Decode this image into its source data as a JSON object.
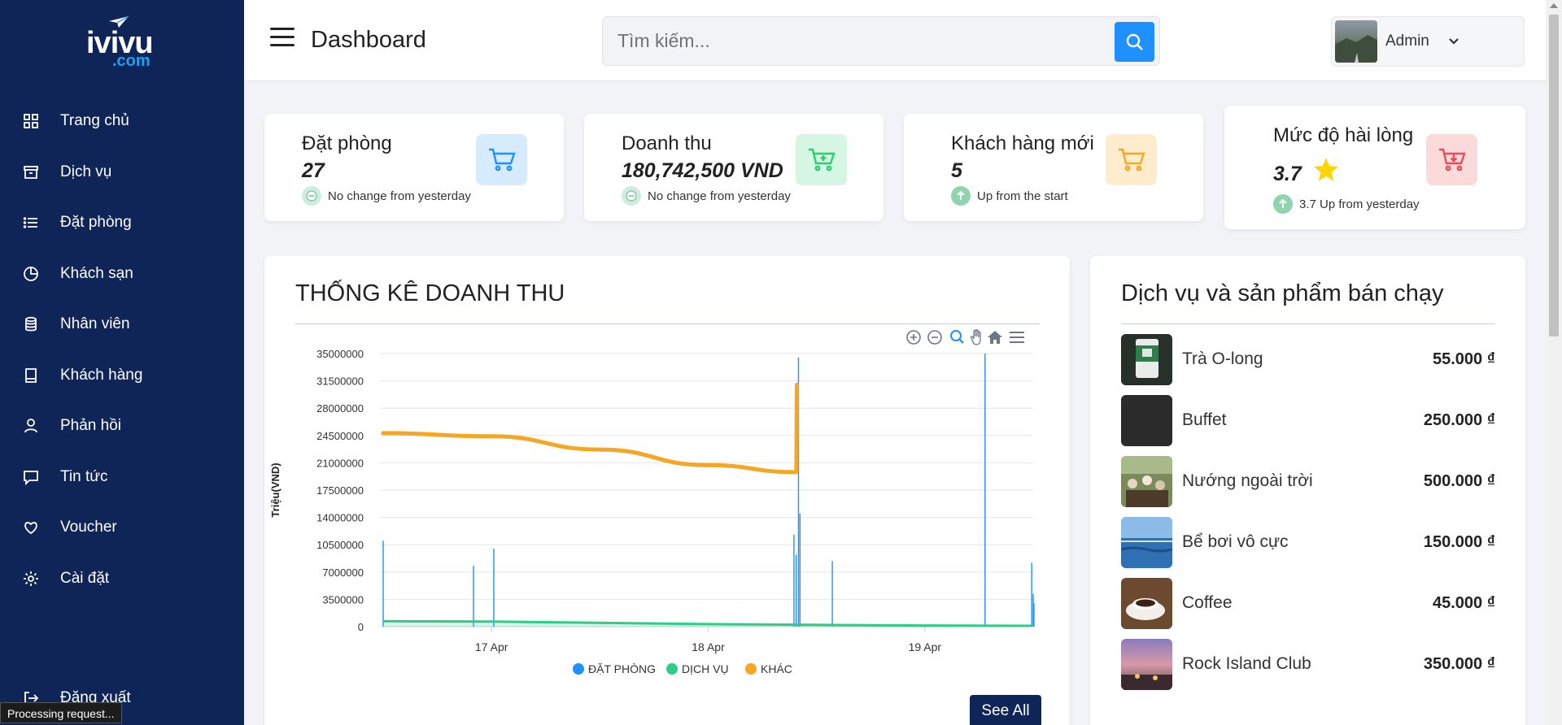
{
  "sidebar": {
    "logo": {
      "main": "ivivu",
      "sub": ".com"
    },
    "items": [
      {
        "label": "Trang chủ",
        "icon": "grid-icon"
      },
      {
        "label": "Dịch vụ",
        "icon": "archive-icon"
      },
      {
        "label": "Đặt phòng",
        "icon": "list-icon"
      },
      {
        "label": "Khách sạn",
        "icon": "pie-chart-icon"
      },
      {
        "label": "Nhân viên",
        "icon": "database-icon"
      },
      {
        "label": "Khách hàng",
        "icon": "book-icon"
      },
      {
        "label": "Phản hồi",
        "icon": "user-icon"
      },
      {
        "label": "Tin tức",
        "icon": "message-icon"
      },
      {
        "label": "Voucher",
        "icon": "heart-icon"
      },
      {
        "label": "Cài đặt",
        "icon": "gear-icon"
      }
    ],
    "logout_label": "Đăng xuất"
  },
  "status_bar": "Processing request...",
  "header": {
    "title": "Dashboard",
    "search_placeholder": "Tìm kiếm...",
    "user_name": "Admin"
  },
  "stats": [
    {
      "label": "Đặt phòng",
      "value": "27",
      "note": "No change from yesterday",
      "note_kind": "neutral",
      "accent": "#1e90ff",
      "icon_bg": "#d7ebff",
      "icon": "cart-icon"
    },
    {
      "label": "Doanh thu",
      "value": "180,742,500 VND",
      "note": "No change from yesterday",
      "note_kind": "neutral",
      "accent": "#2ecc71",
      "icon_bg": "#d4f6e2",
      "icon": "cart-plus-icon"
    },
    {
      "label": "Khách hàng mới",
      "value": "5",
      "note": "Up from the start",
      "note_kind": "up",
      "accent": "#f5a623",
      "icon_bg": "#ffeccc",
      "icon": "cart-icon"
    },
    {
      "label": "Mức độ hài lòng",
      "value": "3.7",
      "note": "3.7 Up from yesterday",
      "note_kind": "up",
      "accent": "#e74c5c",
      "icon_bg": "#fbdada",
      "icon": "cart-download-icon"
    }
  ],
  "revenue": {
    "title": "THỐNG KÊ DOANH THU",
    "see_all": "See All"
  },
  "chart_data": {
    "type": "line",
    "title": "THỐNG KÊ DOANH THU",
    "ylabel": "Triệu(VND)",
    "xlabel": "",
    "ylim": [
      0,
      35000000
    ],
    "yticks": [
      "35000000",
      "31500000",
      "28000000",
      "24500000",
      "21000000",
      "17500000",
      "14000000",
      "10500000",
      "7000000",
      "3500000",
      "0"
    ],
    "xticks": [
      "17 Apr",
      "18 Apr",
      "19 Apr"
    ],
    "x_range": [
      "2024-04-16 12:00",
      "2024-04-19 12:00"
    ],
    "grid": true,
    "legend_position": "bottom",
    "series": [
      {
        "name": "ĐẶT PHÒNG",
        "color": "#1e90ff",
        "style": "spikes",
        "points": [
          [
            "2024-04-16 12:00",
            11000000
          ],
          [
            "2024-04-16 22:00",
            7800000
          ],
          [
            "2024-04-17 00:15",
            10000000
          ],
          [
            "2024-04-18 09:30",
            11800000
          ],
          [
            "2024-04-18 09:45",
            9200000
          ],
          [
            "2024-04-18 10:00",
            34500000
          ],
          [
            "2024-04-18 10:10",
            14500000
          ],
          [
            "2024-04-18 13:45",
            8400000
          ],
          [
            "2024-04-19 06:40",
            35000000
          ],
          [
            "2024-04-19 11:50",
            8200000
          ],
          [
            "2024-04-19 12:00",
            4200000
          ],
          [
            "2024-04-19 12:05",
            3000000
          ]
        ]
      },
      {
        "name": "DỊCH VỤ",
        "color": "#2ecc8a",
        "style": "area",
        "points": [
          [
            "2024-04-16 12:00",
            700000
          ],
          [
            "2024-04-17 00:00",
            650000
          ],
          [
            "2024-04-18 00:00",
            320000
          ],
          [
            "2024-04-19 00:00",
            150000
          ],
          [
            "2024-04-19 12:00",
            100000
          ]
        ]
      },
      {
        "name": "KHÁC",
        "color": "#f5a623",
        "style": "line",
        "points": [
          [
            "2024-04-16 12:00",
            24800000
          ],
          [
            "2024-04-17 00:00",
            24400000
          ],
          [
            "2024-04-17 12:00",
            22700000
          ],
          [
            "2024-04-18 00:00",
            20700000
          ],
          [
            "2024-04-18 09:45",
            19800000
          ],
          [
            "2024-04-18 09:50",
            31000000
          ]
        ]
      }
    ]
  },
  "products": {
    "title": "Dịch vụ và sản phẩm bán chạy",
    "items": [
      {
        "name": "Trà O-long",
        "price": "55.000 ₫",
        "thumb": "tea-package"
      },
      {
        "name": "Buffet",
        "price": "250.000 ₫",
        "thumb": "plain-dark"
      },
      {
        "name": "Nướng ngoài trời",
        "price": "500.000 ₫",
        "thumb": "outdoor-bbq"
      },
      {
        "name": "Bể bơi vô cực",
        "price": "150.000 ₫",
        "thumb": "infinity-pool"
      },
      {
        "name": "Coffee",
        "price": "45.000 ₫",
        "thumb": "coffee-cup"
      },
      {
        "name": "Rock Island Club",
        "price": "350.000 ₫",
        "thumb": "sunset-club"
      }
    ]
  }
}
